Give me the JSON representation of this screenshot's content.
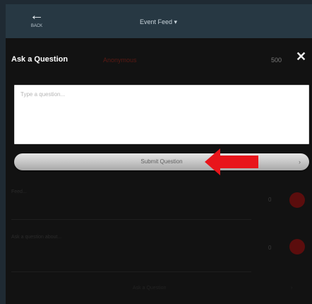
{
  "topbar": {
    "back_label": "BACK",
    "title": "Event Feed ▾"
  },
  "modal": {
    "title": "Ask a Question",
    "subtitle": "Anonymous",
    "char_counter": "500",
    "close_glyph": "✕",
    "input_placeholder": "Type a question...",
    "submit_label": "Submit Question",
    "submit_chevron": "›"
  },
  "background_rows": [
    {
      "text": "Feed...",
      "count": "0"
    },
    {
      "text": "Ask a question about...",
      "count": "0"
    }
  ],
  "footer": {
    "label": "Ask a Question",
    "chevron": "›"
  },
  "colors": {
    "highlight_arrow": "#e8151b"
  }
}
